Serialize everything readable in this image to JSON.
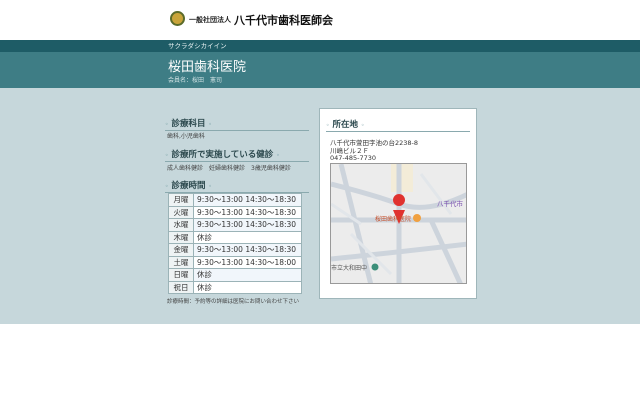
{
  "header": {
    "org_type": "一般社団法人",
    "org_name": "八千代市歯科医師会"
  },
  "clinic": {
    "kana": "サクラダシカイイン",
    "name": "桜田歯科医院",
    "member": "会員名：桜田　憲司"
  },
  "departments": {
    "heading": "診療科目",
    "text": "歯科,小児歯科"
  },
  "checkups": {
    "heading": "診療所で実施している健診",
    "text": "成人歯科健診　妊婦歯科健診　3歳児歯科健診"
  },
  "hours": {
    "heading": "診療時間",
    "rows": [
      {
        "day": "月曜",
        "time": "9:30～13:00 14:30～18:30"
      },
      {
        "day": "火曜",
        "time": "9:30～13:00 14:30～18:30"
      },
      {
        "day": "水曜",
        "time": "9:30～13:00 14:30～18:30"
      },
      {
        "day": "木曜",
        "time": "休診"
      },
      {
        "day": "金曜",
        "time": "9:30～13:00 14:30～18:30"
      },
      {
        "day": "土曜",
        "time": "9:30～13:00 14:30～18:00"
      },
      {
        "day": "日曜",
        "time": "休診"
      },
      {
        "day": "祝日",
        "time": "休診"
      }
    ],
    "note": "診療時間：予約等の詳細は医院にお問い合わせ下さい"
  },
  "location": {
    "heading": "所在地",
    "address1": "八千代市萱田字池の台2238-8",
    "address2": "川嶋ビル２Ｆ",
    "phone": "047-485-7730",
    "map_labels": {
      "place": "桜田歯科医院",
      "city": "八千代市",
      "school": "市立大和田中"
    }
  }
}
